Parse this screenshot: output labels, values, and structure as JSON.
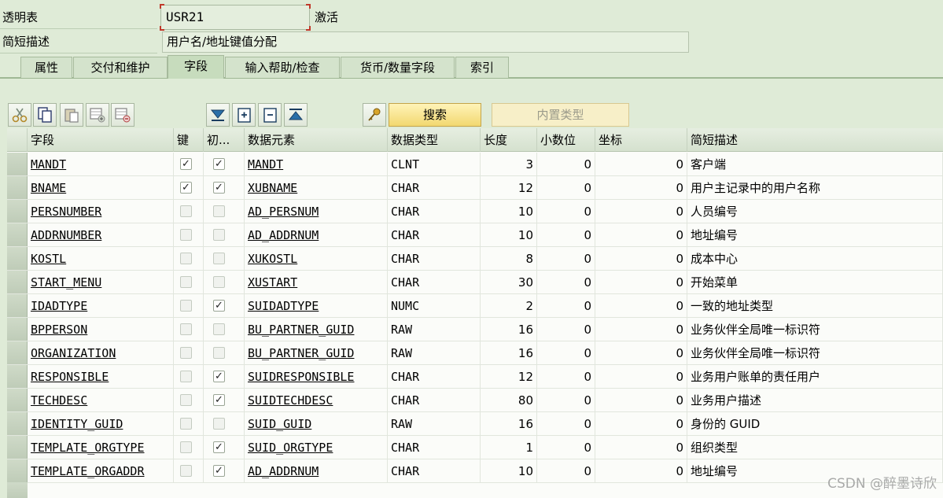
{
  "header": {
    "table_label": "透明表",
    "table_value": "USR21",
    "status": "激活",
    "desc_label": "简短描述",
    "desc_value": "用户名/地址键值分配"
  },
  "tabs": [
    {
      "label": "属性",
      "active": false
    },
    {
      "label": "交付和维护",
      "active": false
    },
    {
      "label": "字段",
      "active": true
    },
    {
      "label": "输入帮助/检查",
      "active": false
    },
    {
      "label": "货币/数量字段",
      "active": false
    },
    {
      "label": "索引",
      "active": false
    }
  ],
  "toolbar": {
    "icons": [
      "cut-icon",
      "copy-icon",
      "paste-icon",
      "insert-row-icon",
      "delete-row-icon",
      "move-down-icon",
      "expand-icon",
      "collapse-icon",
      "move-up-icon",
      "key-help-icon"
    ],
    "search_label": "搜索",
    "builtin_type_label": "内置类型"
  },
  "table": {
    "columns": [
      "字段",
      "键",
      "初...",
      "数据元素",
      "数据类型",
      "长度",
      "小数位",
      "坐标",
      "简短描述"
    ],
    "rows": [
      {
        "field": "MANDT",
        "key": true,
        "init": true,
        "element": "MANDT",
        "type": "CLNT",
        "length": "3",
        "decimals": "0",
        "coord": "0",
        "desc": "客户端"
      },
      {
        "field": "BNAME",
        "key": true,
        "init": true,
        "element": "XUBNAME",
        "type": "CHAR",
        "length": "12",
        "decimals": "0",
        "coord": "0",
        "desc": "用户主记录中的用户名称"
      },
      {
        "field": "PERSNUMBER",
        "key": false,
        "init": false,
        "element": "AD_PERSNUM",
        "type": "CHAR",
        "length": "10",
        "decimals": "0",
        "coord": "0",
        "desc": "人员编号"
      },
      {
        "field": "ADDRNUMBER",
        "key": false,
        "init": false,
        "element": "AD_ADDRNUM",
        "type": "CHAR",
        "length": "10",
        "decimals": "0",
        "coord": "0",
        "desc": "地址编号"
      },
      {
        "field": "KOSTL",
        "key": false,
        "init": false,
        "element": "XUKOSTL",
        "type": "CHAR",
        "length": "8",
        "decimals": "0",
        "coord": "0",
        "desc": "成本中心"
      },
      {
        "field": "START_MENU",
        "key": false,
        "init": false,
        "element": "XUSTART",
        "type": "CHAR",
        "length": "30",
        "decimals": "0",
        "coord": "0",
        "desc": "开始菜单"
      },
      {
        "field": "IDADTYPE",
        "key": false,
        "init": true,
        "element": "SUIDADTYPE",
        "type": "NUMC",
        "length": "2",
        "decimals": "0",
        "coord": "0",
        "desc": "一致的地址类型"
      },
      {
        "field": "BPPERSON",
        "key": false,
        "init": false,
        "element": "BU_PARTNER_GUID",
        "type": "RAW",
        "length": "16",
        "decimals": "0",
        "coord": "0",
        "desc": "业务伙伴全局唯一标识符"
      },
      {
        "field": "ORGANIZATION",
        "key": false,
        "init": false,
        "element": "BU_PARTNER_GUID",
        "type": "RAW",
        "length": "16",
        "decimals": "0",
        "coord": "0",
        "desc": "业务伙伴全局唯一标识符"
      },
      {
        "field": "RESPONSIBLE",
        "key": false,
        "init": true,
        "element": "SUIDRESPONSIBLE",
        "type": "CHAR",
        "length": "12",
        "decimals": "0",
        "coord": "0",
        "desc": "业务用户账单的责任用户"
      },
      {
        "field": "TECHDESC",
        "key": false,
        "init": true,
        "element": "SUIDTECHDESC",
        "type": "CHAR",
        "length": "80",
        "decimals": "0",
        "coord": "0",
        "desc": "业务用户描述"
      },
      {
        "field": "IDENTITY_GUID",
        "key": false,
        "init": false,
        "element": "SUID_GUID",
        "type": "RAW",
        "length": "16",
        "decimals": "0",
        "coord": "0",
        "desc": "身份的 GUID"
      },
      {
        "field": "TEMPLATE_ORGTYPE",
        "key": false,
        "init": true,
        "element": "SUID_ORGTYPE",
        "type": "CHAR",
        "length": "1",
        "decimals": "0",
        "coord": "0",
        "desc": "组织类型"
      },
      {
        "field": "TEMPLATE_ORGADDR",
        "key": false,
        "init": true,
        "element": "AD_ADDRNUM",
        "type": "CHAR",
        "length": "10",
        "decimals": "0",
        "coord": "0",
        "desc": "地址编号"
      }
    ]
  },
  "watermark": "CSDN @醉墨诗欣"
}
